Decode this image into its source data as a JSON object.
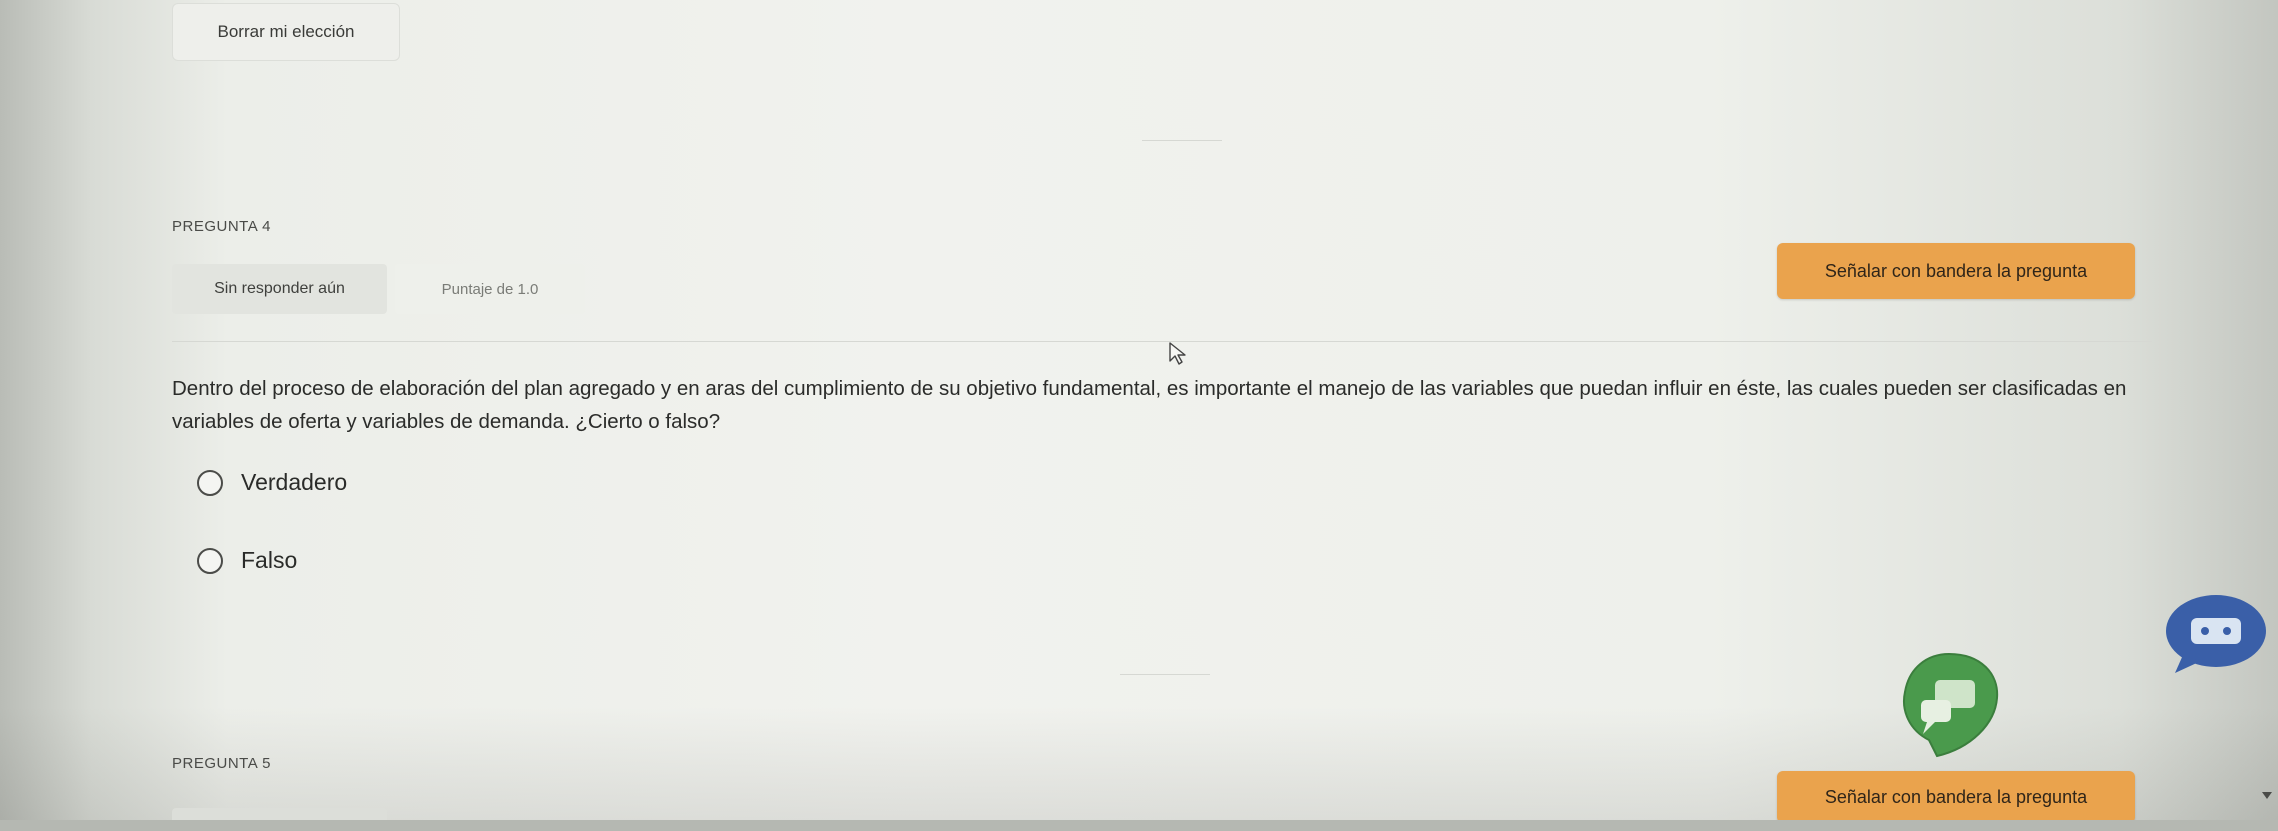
{
  "top": {
    "clear_choice_label": "Borrar mi elección"
  },
  "question4": {
    "label": "PREGUNTA 4",
    "status": "Sin responder aún",
    "score": "Puntaje de 1.0",
    "flag_label": "Señalar con bandera la pregunta",
    "text": "Dentro del proceso de elaboración del plan agregado y en aras del cumplimiento de su objetivo fundamental, es importante el manejo de las variables que puedan influir en éste, las cuales pueden ser clasificadas en variables de oferta y variables de demanda. ¿Cierto o falso?",
    "options": [
      "Verdadero",
      "Falso"
    ]
  },
  "question5": {
    "label": "PREGUNTA 5",
    "flag_label": "Señalar con bandera la pregunta"
  },
  "colors": {
    "accent_orange": "#eaa34d",
    "chat_blue": "#3a5fa8",
    "widget_green": "#4a9a4c"
  },
  "icons": {
    "cursor": "mouse-cursor-icon",
    "chat": "chat-bubble-icon",
    "widget": "chat-widget-icon",
    "scroll": "chevron-down-icon"
  }
}
